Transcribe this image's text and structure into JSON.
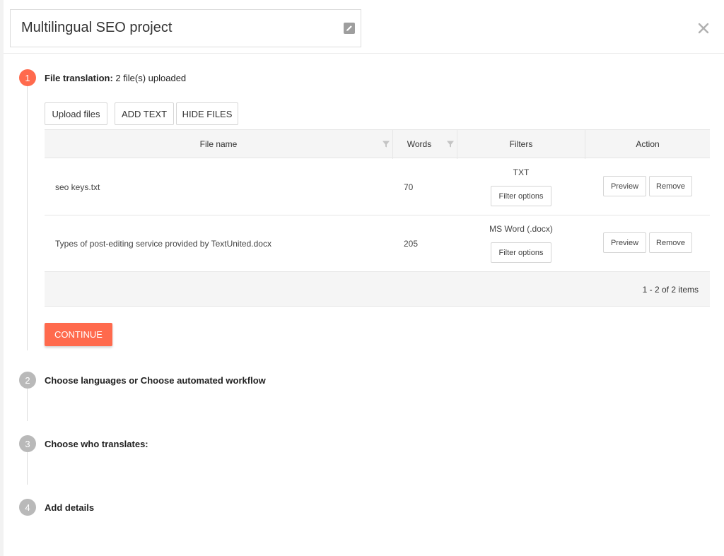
{
  "project": {
    "title": "Multilingual SEO project"
  },
  "steps": [
    {
      "number": "1",
      "title": "File translation:",
      "detail": "2 file(s) uploaded"
    },
    {
      "number": "2",
      "title": "Choose languages or Choose automated workflow"
    },
    {
      "number": "3",
      "title": "Choose who translates:"
    },
    {
      "number": "4",
      "title": "Add details"
    }
  ],
  "toolbar": {
    "upload_label": "Upload files",
    "add_text_label": "ADD TEXT",
    "hide_files_label": "HIDE FILES"
  },
  "table": {
    "columns": [
      "File name",
      "Words",
      "Filters",
      "Action"
    ],
    "rows": [
      {
        "file_name": "seo keys.txt",
        "words": "70",
        "filter": "TXT",
        "filter_button": "Filter options",
        "preview": "Preview",
        "remove": "Remove"
      },
      {
        "file_name": "Types of post-editing service provided by TextUnited.docx",
        "words": "205",
        "filter": "MS Word (.docx)",
        "filter_button": "Filter options",
        "preview": "Preview",
        "remove": "Remove"
      }
    ],
    "pager_info": "1 - 2 of 2 items"
  },
  "continue_label": "CONTINUE",
  "colors": {
    "accent": "#ff6a4d",
    "inactive_step": "#b9b9b9"
  },
  "icons": {
    "edit": "edit-icon",
    "close": "close-icon",
    "filter": "filter-icon"
  }
}
